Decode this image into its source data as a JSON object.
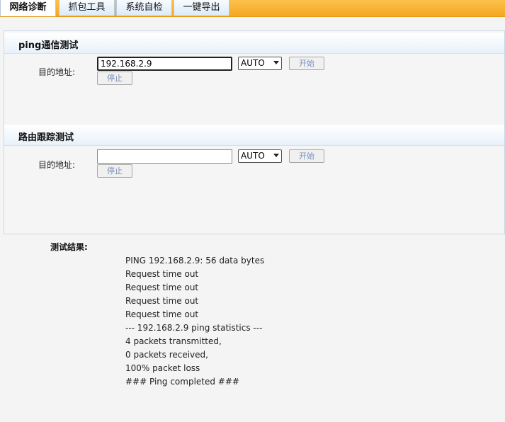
{
  "tabs": [
    {
      "label": "网络诊断",
      "active": true
    },
    {
      "label": "抓包工具",
      "active": false
    },
    {
      "label": "系统自检",
      "active": false
    },
    {
      "label": "一键导出",
      "active": false
    }
  ],
  "ping": {
    "title": "ping通信测试",
    "dest_label": "目的地址:",
    "dest_value": "192.168.2.9",
    "select_value": "AUTO",
    "start_label": "开始",
    "stop_label": "停止"
  },
  "traceroute": {
    "title": "路由跟踪测试",
    "dest_label": "目的地址:",
    "dest_value": "",
    "select_value": "AUTO",
    "start_label": "开始",
    "stop_label": "停止"
  },
  "results": {
    "label": "测试结果:",
    "lines": [
      "PING 192.168.2.9: 56 data bytes",
      "Request time out",
      "Request time out",
      "Request time out",
      "Request time out",
      "--- 192.168.2.9 ping statistics ---",
      "4 packets transmitted,",
      "0 packets received,",
      "100% packet loss",
      "### Ping completed ###"
    ]
  },
  "colors": {
    "tabbar_bg": "#f5a623",
    "button_text": "#7a8fb8",
    "panel_border": "#c9d9e8"
  }
}
